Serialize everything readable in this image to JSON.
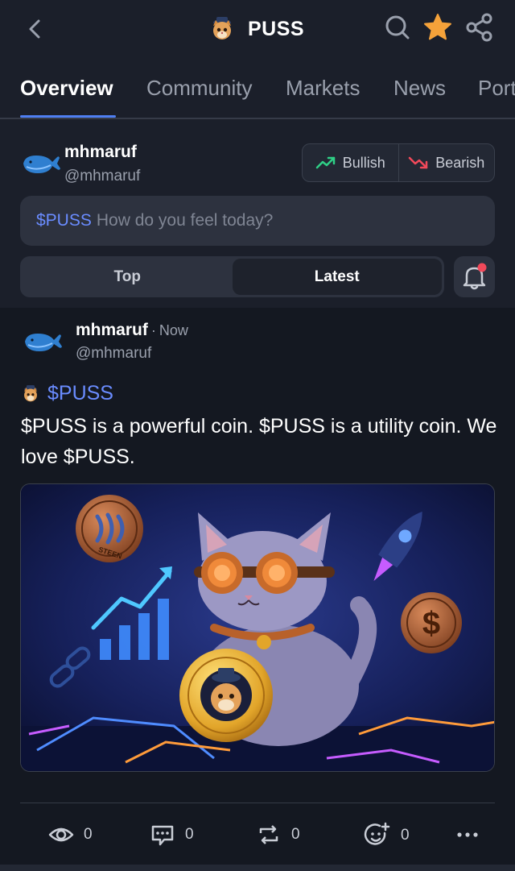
{
  "header": {
    "title": "PUSS",
    "back_icon": "chevron-left-icon",
    "search_icon": "search-icon",
    "star_icon": "star-icon",
    "share_icon": "share-icon",
    "star_color": "#f5a23a"
  },
  "tabs": [
    {
      "label": "Overview",
      "active": true
    },
    {
      "label": "Community",
      "active": false
    },
    {
      "label": "Markets",
      "active": false
    },
    {
      "label": "News",
      "active": false
    },
    {
      "label": "Port",
      "active": false
    }
  ],
  "composer": {
    "user_name": "mhmaruf",
    "user_handle": "@mhmaruf",
    "bullish_label": "Bullish",
    "bearish_label": "Bearish",
    "ticker": "$PUSS",
    "placeholder": "How do you feel today?",
    "sort_options": [
      "Top",
      "Latest"
    ],
    "sort_selected": "Latest",
    "bullish_color": "#2fcf86",
    "bearish_color": "#f2495a"
  },
  "post": {
    "user_name": "mhmaruf",
    "time": "Now",
    "user_handle": "@mhmaruf",
    "coin_tag": "$PUSS",
    "body": "$PUSS is a powerful coin. $PUSS is a utility coin. We love $PUSS.",
    "image_coin_text": "STEEN",
    "image_dollar": "$",
    "stats": {
      "views": "0",
      "comments": "0",
      "reposts": "0",
      "reactions": "0"
    }
  },
  "colors": {
    "accent": "#4f7ff2",
    "ticker": "#6a8cff",
    "background": "#1b1f2a",
    "feed_background": "#141821"
  }
}
